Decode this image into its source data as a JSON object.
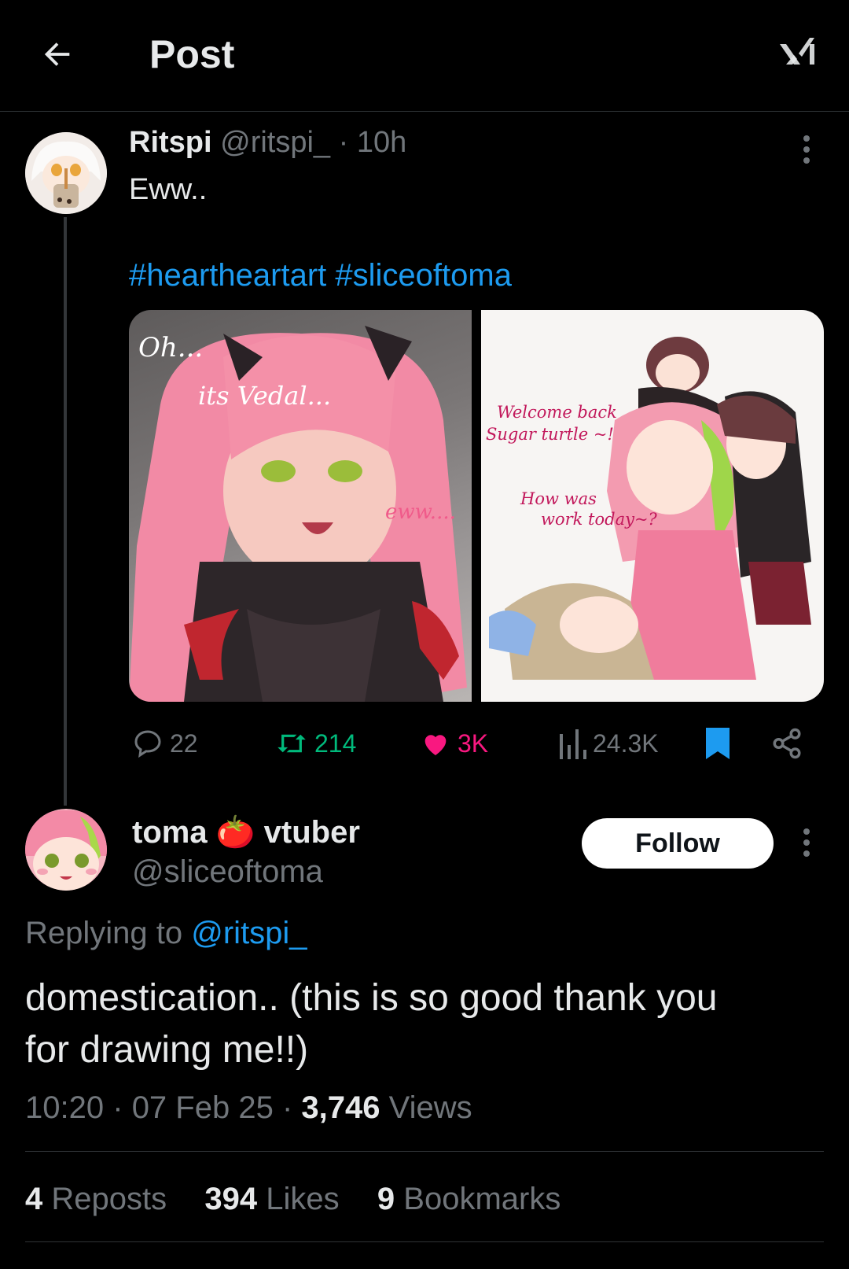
{
  "header": {
    "title": "Post"
  },
  "parent_post": {
    "author_name": "Ritspi",
    "handle": "@ritspi_",
    "separator": "·",
    "time": "10h",
    "text": "Eww..",
    "hashtags": "#heartheartart #sliceoftoma",
    "media": [
      {
        "texts": [
          "Oh...",
          "its Vedal...",
          "eww...."
        ]
      },
      {
        "texts": [
          "Welcome back",
          "Sugar turtle ~!",
          "How was",
          "work today~?"
        ]
      }
    ],
    "actions": {
      "replies": "22",
      "reposts": "214",
      "likes": "3K",
      "views": "24.3K"
    },
    "colors": {
      "repost": "#00ba7c",
      "like": "#f91880",
      "bookmark": "#1d9bf0"
    }
  },
  "reply_post": {
    "display_name_part1": "toma",
    "display_name_emoji": "🍅",
    "display_name_part2": "vtuber",
    "handle": "@sliceoftoma",
    "follow_label": "Follow",
    "replying_to_prefix": "Replying to",
    "replying_to_handle": "@ritspi_",
    "text_line1": "domestication.. (this is so good thank you",
    "text_line2": "for drawing me!!)",
    "time": "10:20",
    "date": "07 Feb 25",
    "views_count": "3,746",
    "views_label": "Views",
    "stats": {
      "reposts_count": "4",
      "reposts_label": "Reposts",
      "likes_count": "394",
      "likes_label": "Likes",
      "bookmarks_count": "9",
      "bookmarks_label": "Bookmarks"
    }
  }
}
